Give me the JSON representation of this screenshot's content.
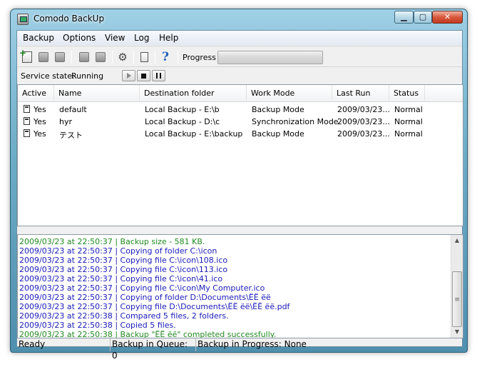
{
  "window": {
    "title": "Comodo BackUp"
  },
  "menu": [
    "Backup",
    "Options",
    "View",
    "Log",
    "Help"
  ],
  "toolbar": {
    "icons": [
      "new-backup-icon",
      "restore-icon",
      "delete-backup-icon",
      "run-backup-icon",
      "stop-backup-icon",
      "settings-gear-icon",
      "log-document-icon",
      "help-icon"
    ],
    "progress_label": "Progress",
    "progress_value": 0
  },
  "service": {
    "label": "Service state:",
    "value": "Running"
  },
  "table": {
    "columns": [
      "Active",
      "Name",
      "Destination folder",
      "Work Mode",
      "Last Run",
      "Status"
    ],
    "rows": [
      {
        "active": "Yes",
        "name": "default",
        "destination": "Local Backup - E:\\b",
        "mode": "Backup Mode",
        "last_run": "2009/03/23...",
        "status": "Normal"
      },
      {
        "active": "Yes",
        "name": "hyr",
        "destination": "Local Backup - D:\\c",
        "mode": "Synchronization Mode",
        "last_run": "2009/03/23...",
        "status": "Normal"
      },
      {
        "active": "Yes",
        "name": "テスト",
        "destination": "Local Backup - E:\\backup",
        "mode": "Backup Mode",
        "last_run": "2009/03/23...",
        "status": "Normal"
      }
    ]
  },
  "log": [
    {
      "text": "2009/03/23 at 22:50:37 | Backup size - 581 KB.",
      "color": "green"
    },
    {
      "text": "2009/03/23 at 22:50:37 | Copying of folder C:\\icon",
      "color": "blue"
    },
    {
      "text": "2009/03/23 at 22:50:37 | Copying file C:\\icon\\108.ico",
      "color": "blue"
    },
    {
      "text": "2009/03/23 at 22:50:37 | Copying file C:\\icon\\113.ico",
      "color": "blue"
    },
    {
      "text": "2009/03/23 at 22:50:37 | Copying file C:\\icon\\41.ico",
      "color": "blue"
    },
    {
      "text": "2009/03/23 at 22:50:37 | Copying file C:\\icon\\My Computer.ico",
      "color": "blue"
    },
    {
      "text": "2009/03/23 at 22:50:37 | Copying of folder D:\\Documents\\ЁЁ ёё",
      "color": "blue"
    },
    {
      "text": "2009/03/23 at 22:50:37 | Copying file D:\\Documents\\ЁЁ ёё\\ЁЁ ёё.pdf",
      "color": "blue"
    },
    {
      "text": "2009/03/23 at 22:50:38 | Compared 5 files, 2 folders.",
      "color": "blue"
    },
    {
      "text": "2009/03/23 at 22:50:38 | Copied 5 files.",
      "color": "blue"
    },
    {
      "text": "2009/03/23 at 22:50:38 | Backup \"ЁЁ ёё\" completed successfully.",
      "color": "green"
    }
  ],
  "status": {
    "ready": "Ready",
    "queue": "Backup in Queue: 0",
    "in_progress": "Backup in Progress: None"
  },
  "colors": {
    "log_green": "#1f8a1f",
    "log_blue": "#1a1ab8",
    "titlebar": "#6faec9"
  }
}
